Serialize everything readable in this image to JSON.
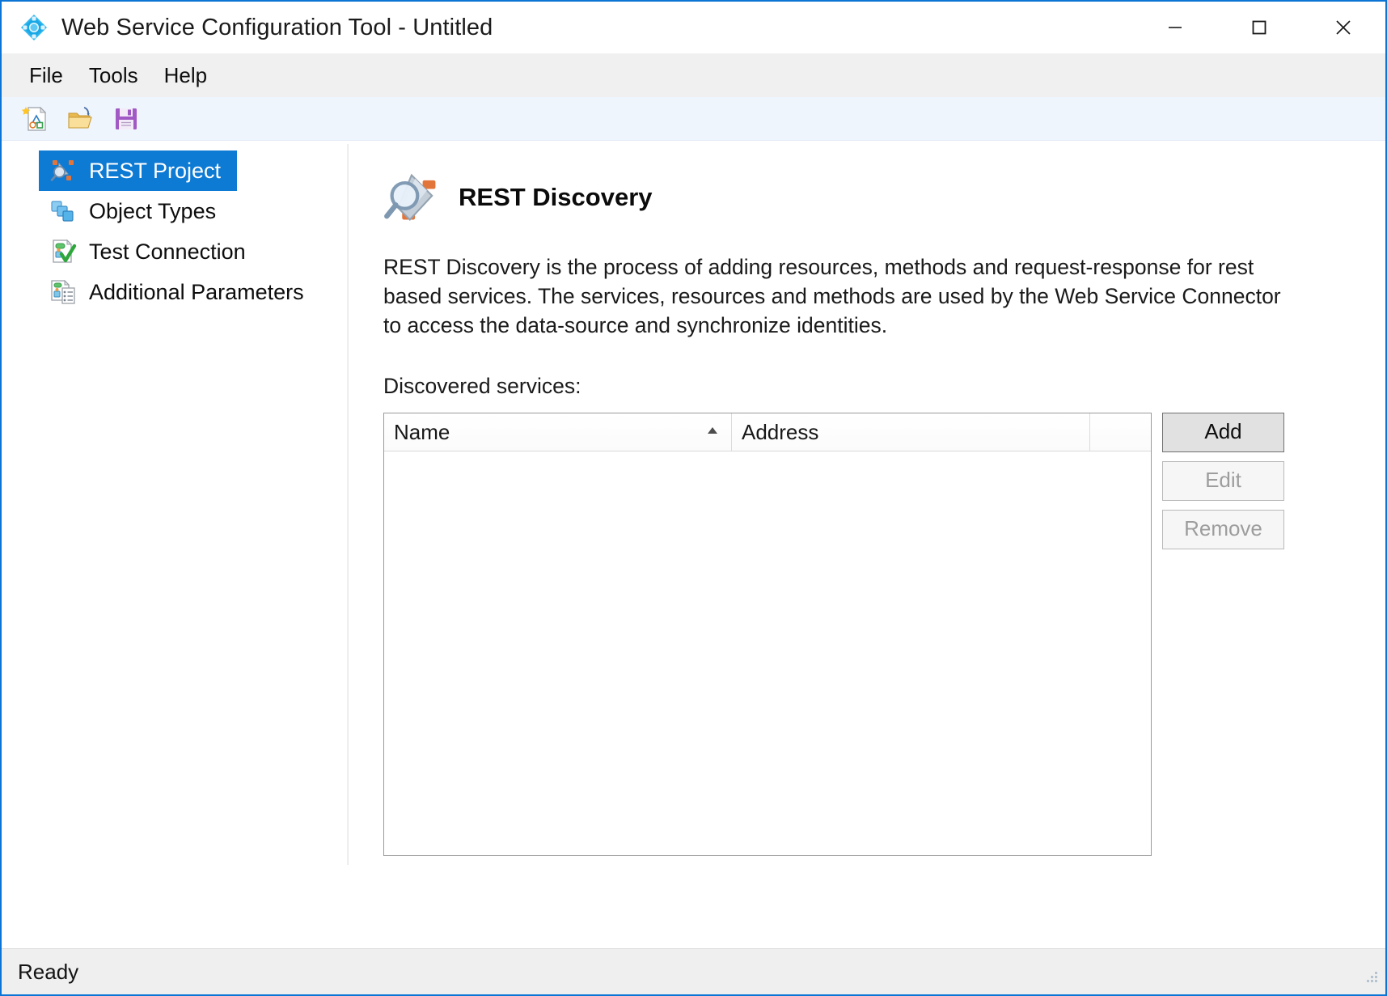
{
  "window": {
    "title": "Web Service Configuration Tool - Untitled",
    "app_icon": "diamond-node-icon",
    "controls": {
      "minimize": "minimize-icon",
      "maximize": "maximize-icon",
      "close": "close-icon"
    },
    "accent_color": "#0b74d4"
  },
  "menubar": {
    "items": [
      {
        "label": "File"
      },
      {
        "label": "Tools"
      },
      {
        "label": "Help"
      }
    ]
  },
  "toolbar": {
    "buttons": [
      {
        "name": "new-project-button",
        "icon": "new-document-icon",
        "tooltip": "New"
      },
      {
        "name": "open-project-button",
        "icon": "open-folder-icon",
        "tooltip": "Open"
      },
      {
        "name": "save-project-button",
        "icon": "save-floppy-icon",
        "tooltip": "Save"
      }
    ]
  },
  "sidebar": {
    "selected_index": 0,
    "selection_color": "#0d7ad4",
    "items": [
      {
        "label": "REST Project",
        "icon": "satellite-search-icon",
        "selected": true
      },
      {
        "label": "Object Types",
        "icon": "stacked-squares-icon",
        "selected": false
      },
      {
        "label": "Test Connection",
        "icon": "document-check-icon",
        "selected": false
      },
      {
        "label": "Additional Parameters",
        "icon": "document-list-icon",
        "selected": false
      }
    ]
  },
  "main": {
    "title": "REST Discovery",
    "title_icon": "satellite-search-icon",
    "description": "REST Discovery is the process of adding resources, methods and request-response for rest based services. The services, resources and methods are used by the Web Service Connector to access the data-source and synchronize identities.",
    "list_label": "Discovered services:",
    "table": {
      "columns": [
        {
          "label": "Name",
          "sort": "ascending"
        },
        {
          "label": "Address",
          "sort": "none"
        },
        {
          "label": "",
          "sort": "none"
        }
      ],
      "rows": []
    },
    "buttons": [
      {
        "label": "Add",
        "enabled": true
      },
      {
        "label": "Edit",
        "enabled": false
      },
      {
        "label": "Remove",
        "enabled": false
      }
    ]
  },
  "statusbar": {
    "text": "Ready",
    "grip": "resize-grip-icon"
  }
}
